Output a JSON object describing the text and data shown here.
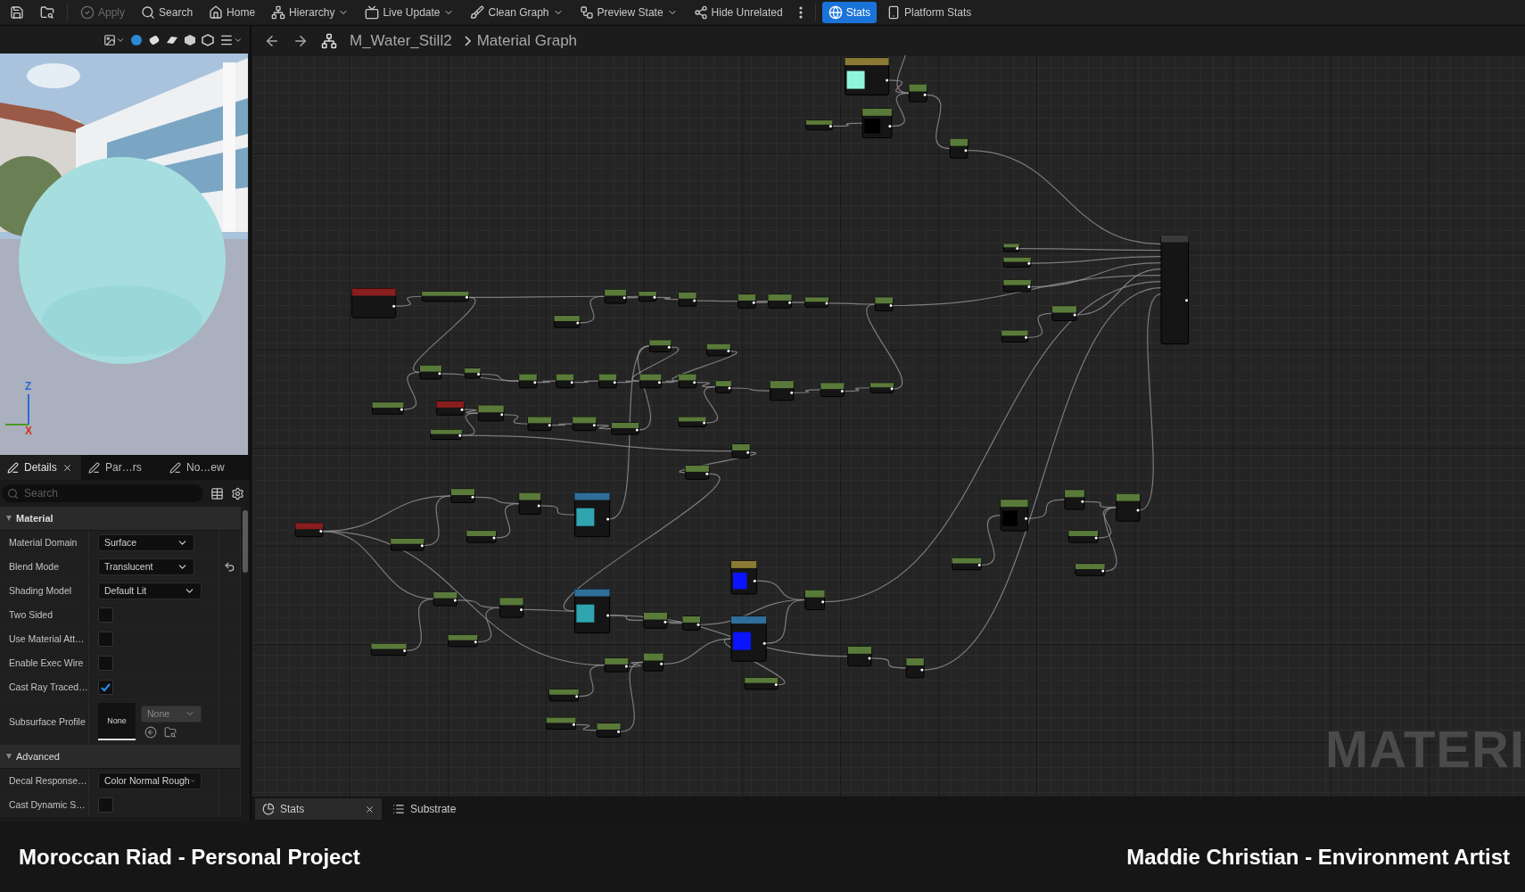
{
  "toolbar": [
    {
      "disabled": false,
      "caret": false,
      "selected": false
    },
    {
      "disabled": false,
      "caret": false,
      "selected": false
    },
    {
      "label": "Apply",
      "disabled": true,
      "caret": false,
      "selected": false
    },
    {
      "label": "Search",
      "disabled": false,
      "caret": false,
      "selected": false
    },
    {
      "label": "Home",
      "disabled": false,
      "caret": false,
      "selected": false
    },
    {
      "label": "Hierarchy",
      "disabled": false,
      "caret": true,
      "selected": false
    },
    {
      "label": "Live Update",
      "disabled": false,
      "caret": true,
      "selected": false
    },
    {
      "label": "Clean Graph",
      "disabled": false,
      "caret": true,
      "selected": false
    },
    {
      "label": "Preview State",
      "disabled": false,
      "caret": true,
      "selected": false
    },
    {
      "label": "Hide Unrelated",
      "disabled": false,
      "caret": false,
      "selected": false
    },
    {
      "disabled": false,
      "caret": false,
      "selected": false
    },
    {
      "label": "Stats",
      "disabled": false,
      "caret": false,
      "selected": true
    },
    {
      "label": "Platform Stats",
      "disabled": false,
      "caret": false,
      "selected": false
    }
  ],
  "viewport": {
    "axes": [
      "Z",
      "X"
    ]
  },
  "details": {
    "tabs": [
      {
        "label": "Details",
        "selected": true,
        "closable": true
      },
      {
        "label": "Par…rs",
        "selected": false,
        "closable": false
      },
      {
        "label": "No…ew",
        "selected": false,
        "closable": false
      }
    ],
    "search": {
      "placeholder": "Search"
    },
    "sections": [
      {
        "title": "Material",
        "expanded": true,
        "rows": [
          {
            "kind": "dropdown",
            "label": "Material Domain",
            "value": "Surface",
            "reset": false
          },
          {
            "kind": "dropdown",
            "label": "Blend Mode",
            "value": "Translucent",
            "reset": true
          },
          {
            "kind": "dropdown",
            "label": "Shading Model",
            "value": "Default Lit",
            "reset": false
          },
          {
            "kind": "checkbox",
            "label": "Two Sided",
            "checked": false
          },
          {
            "kind": "checkbox",
            "label": "Use Material Att…",
            "checked": false
          },
          {
            "kind": "checkbox",
            "label": "Enable Exec Wire",
            "checked": false
          },
          {
            "kind": "checkbox",
            "label": "Cast Ray Traced…",
            "checked": true
          },
          {
            "kind": "profile",
            "label": "Subsurface Profile",
            "thumbnail": "None",
            "value": "None"
          }
        ]
      },
      {
        "title": "Advanced",
        "expanded": true,
        "rows": [
          {
            "kind": "dropdown",
            "label": "Decal Response…",
            "value": "Color Normal Rough",
            "reset": false
          },
          {
            "kind": "checkbox",
            "label": "Cast Dynamic S…",
            "checked": false
          }
        ]
      }
    ]
  },
  "breadcrumb": [
    "M_Water_Still2",
    "Material Graph"
  ],
  "graph": {
    "watermark": "MATERI"
  },
  "bottom_tabs": [
    {
      "label": "Stats",
      "selected": true,
      "closable": true
    },
    {
      "label": "Substrate",
      "selected": false,
      "closable": false
    }
  ],
  "footer": {
    "left": "Moroccan Riad - Personal Project",
    "right": "Maddie Christian - Environment Artist"
  }
}
